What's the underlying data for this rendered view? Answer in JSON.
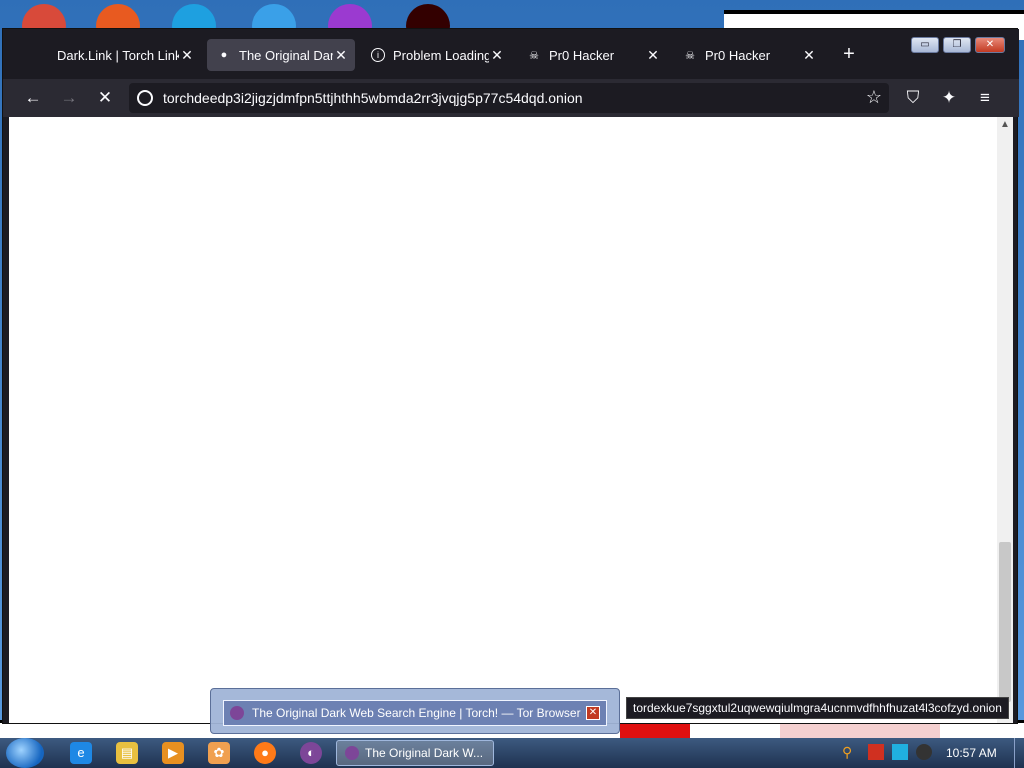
{
  "tabs": [
    {
      "title": "Dark.Link | Torch Links",
      "icon": "none"
    },
    {
      "title": "The Original Dark Web Search Engine",
      "icon": "dot-icon",
      "active": true
    },
    {
      "title": "Problem Loading Page",
      "icon": "info-icon"
    },
    {
      "title": "Pr0 Hacker",
      "icon": "skull-icon"
    },
    {
      "title": "Pr0 Hacker",
      "icon": "skull-icon"
    }
  ],
  "newtab_label": "+",
  "window_controls": {
    "minimize": "▭",
    "restore": "❐",
    "close": "✕"
  },
  "url": "torchdeedp3i2jigzjdmfpn5ttjhthh5wbmda2rr3jvqjg5p77c54dqd.onion",
  "status_url": "tordexkue7sggxtul2uqwewqiulmgra4ucnmvdfhhfhuzat4l3cofzyd.onion",
  "taskbar": {
    "preview_title": "The Original Dark Web Search Engine | Torch! — Tor Browser",
    "task_label": "The Original Dark W...",
    "clock": "10:57 AM"
  }
}
